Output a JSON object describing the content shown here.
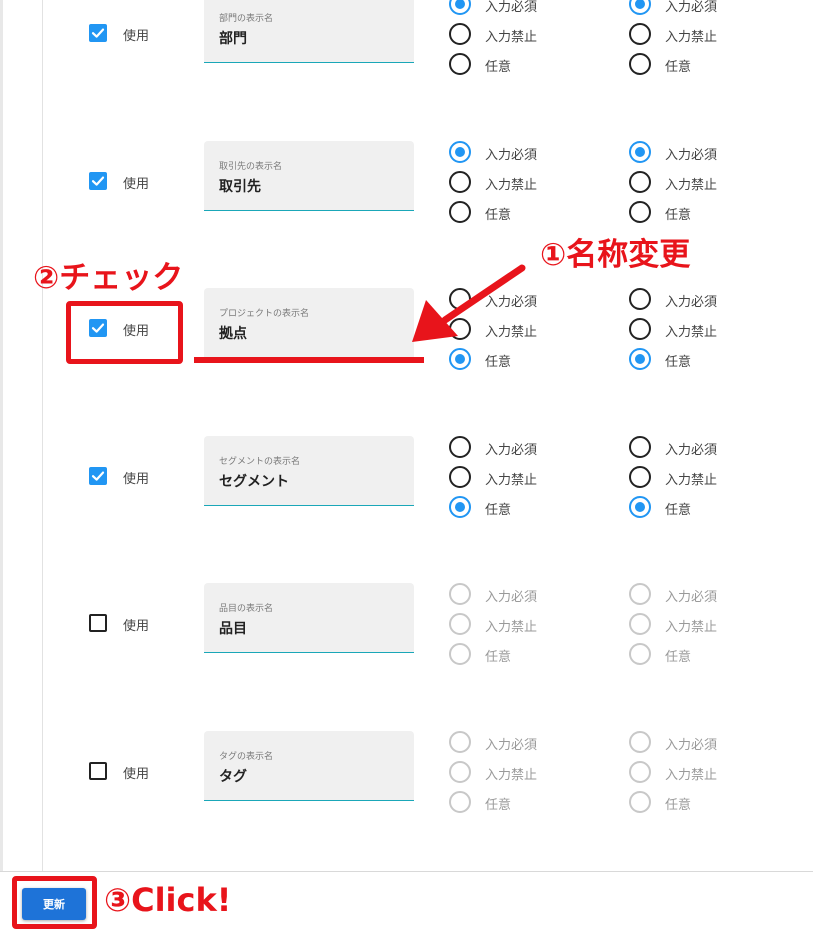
{
  "checkbox_label": "使用",
  "radio_labels": [
    "入力必須",
    "入力禁止",
    "任意"
  ],
  "rows": [
    {
      "checked": true,
      "field_label": "部門の表示名",
      "field_value": "部門",
      "group1": 0,
      "group2": 0
    },
    {
      "checked": true,
      "field_label": "取引先の表示名",
      "field_value": "取引先",
      "group1": 0,
      "group2": 0
    },
    {
      "checked": true,
      "field_label": "プロジェクトの表示名",
      "field_value": "拠点",
      "group1": 2,
      "group2": 2
    },
    {
      "checked": true,
      "field_label": "セグメントの表示名",
      "field_value": "セグメント",
      "group1": 2,
      "group2": 2
    },
    {
      "checked": false,
      "field_label": "品目の表示名",
      "field_value": "品目",
      "group1": -1,
      "group2": -1
    },
    {
      "checked": false,
      "field_label": "タグの表示名",
      "field_value": "タグ",
      "group1": -1,
      "group2": -1
    }
  ],
  "footer": {
    "update_label": "更新"
  },
  "annotations": {
    "step1": "①名称変更",
    "step2": "②チェック",
    "step3": "③Click!",
    "color": "#e8141b"
  },
  "colors": {
    "accent": "#2196f3",
    "button": "#1e73d8",
    "underline": "#1aa7b8"
  }
}
